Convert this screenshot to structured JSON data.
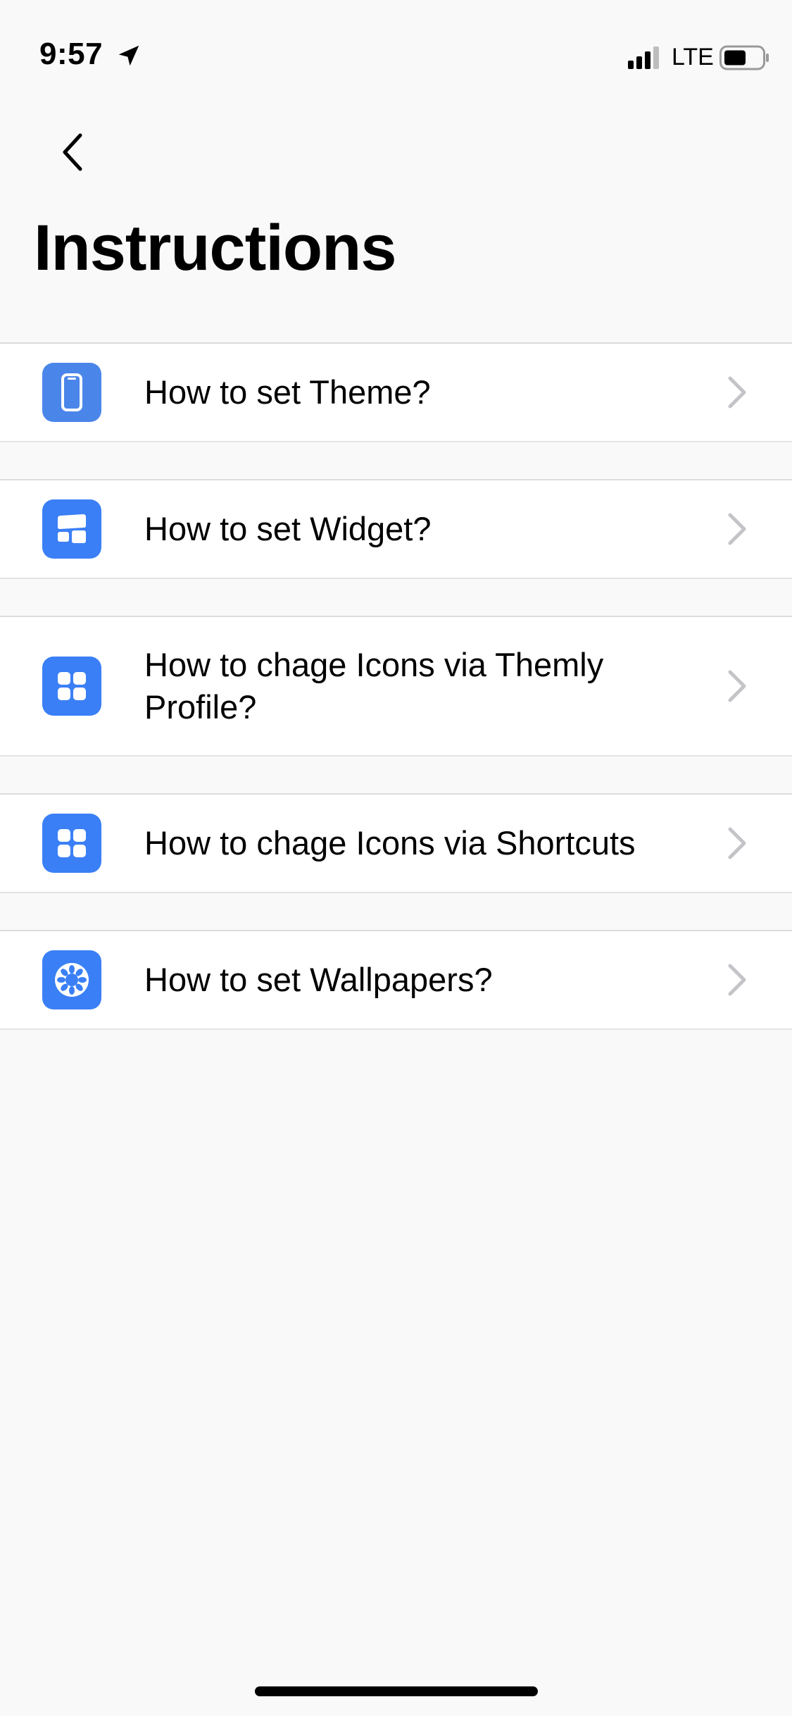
{
  "status_bar": {
    "time": "9:57",
    "network": "LTE",
    "icons": [
      "location-arrow-icon",
      "cellular-signal-icon",
      "battery-icon"
    ]
  },
  "nav": {
    "back_icon": "chevron-left-icon"
  },
  "page": {
    "title": "Instructions"
  },
  "colors": {
    "accent": "#3a7ff6",
    "background": "#f9f9f9",
    "row_background": "#ffffff",
    "chevron": "#c4c4c8"
  },
  "items": [
    {
      "label": "How to set Theme?",
      "icon": "phone-theme-icon"
    },
    {
      "label": "How to set Widget?",
      "icon": "widget-icon"
    },
    {
      "label": "How to chage Icons via Themly Profile?",
      "icon": "app-grid-icon"
    },
    {
      "label": "How to chage Icons via Shortcuts",
      "icon": "app-grid-icon"
    },
    {
      "label": "How to set Wallpapers?",
      "icon": "wallpaper-flower-icon"
    }
  ]
}
